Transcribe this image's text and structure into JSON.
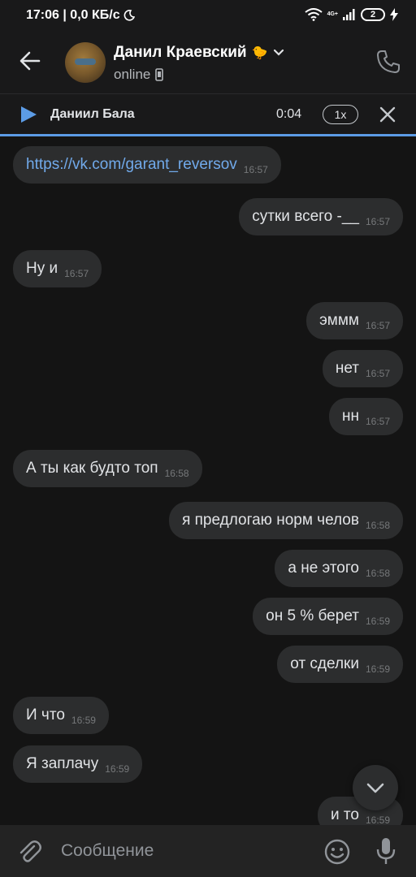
{
  "status_bar": {
    "time_speed": "17:06 | 0,0 КБ/с",
    "network": "4G+",
    "battery": "2"
  },
  "header": {
    "contact_name": "Данил Краевский",
    "name_emoji": "🐤",
    "status": "online"
  },
  "player": {
    "track": "Даниил Бала",
    "time": "0:04",
    "speed": "1x",
    "progress": 0.0
  },
  "messages": [
    {
      "side": "in",
      "text": "https://vk.com/garant_reversov",
      "time": "16:57",
      "link": true
    },
    {
      "side": "out",
      "text": "сутки всего -__",
      "time": "16:57"
    },
    {
      "side": "in",
      "text": "Ну и",
      "time": "16:57"
    },
    {
      "side": "out",
      "text": "эммм",
      "time": "16:57"
    },
    {
      "side": "out",
      "text": "нет",
      "time": "16:57"
    },
    {
      "side": "out",
      "text": "нн",
      "time": "16:57"
    },
    {
      "side": "in",
      "text": "А ты как будто топ",
      "time": "16:58"
    },
    {
      "side": "out",
      "text": "я предлогаю норм челов",
      "time": "16:58"
    },
    {
      "side": "out",
      "text": "а не этого",
      "time": "16:58"
    },
    {
      "side": "out",
      "text": "он 5 % берет",
      "time": "16:59"
    },
    {
      "side": "out",
      "text": "от сделки",
      "time": "16:59"
    },
    {
      "side": "in",
      "text": "И что",
      "time": "16:59"
    },
    {
      "side": "in",
      "text": "Я заплачу",
      "time": "16:59"
    },
    {
      "side": "out",
      "text": "и то",
      "time": "16:59"
    }
  ],
  "composer": {
    "placeholder": "Сообщение"
  },
  "colors": {
    "accent": "#5c9ce6",
    "bubble": "#2c2d2e",
    "link": "#71aaeb",
    "background": "#141414"
  },
  "icons": [
    "back-arrow-icon",
    "phone-icon",
    "play-icon",
    "close-icon",
    "chevron-down-icon",
    "attach-icon",
    "emoji-icon",
    "mic-icon",
    "moon-icon",
    "wifi-icon",
    "signal-icon",
    "charging-icon",
    "mobile-icon"
  ]
}
